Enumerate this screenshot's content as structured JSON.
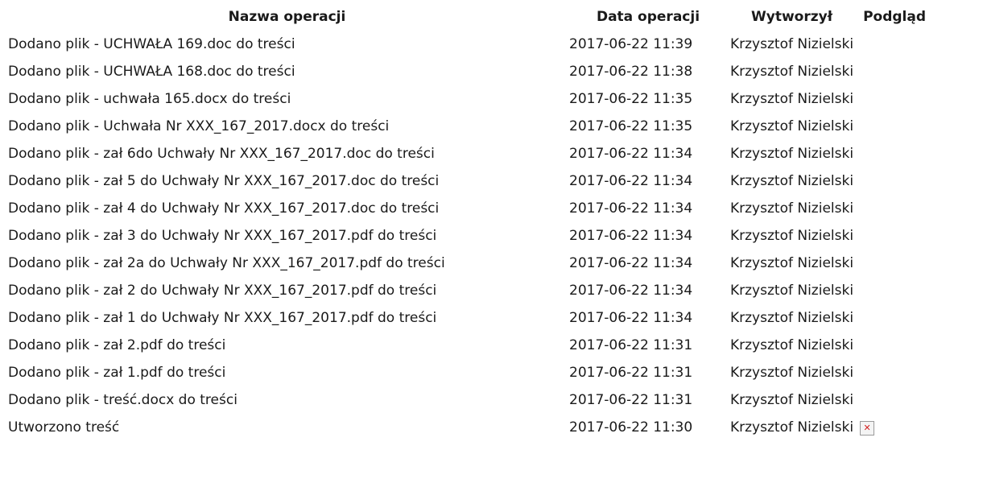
{
  "table": {
    "headers": {
      "name": "Nazwa operacji",
      "date": "Data operacji",
      "user": "Wytworzył",
      "preview": "Podgląd"
    },
    "rows": [
      {
        "name": "Dodano plik - UCHWAŁA 169.doc do treści",
        "date": "2017-06-22 11:39",
        "user": "Krzysztof Nizielski"
      },
      {
        "name": "Dodano plik - UCHWAŁA 168.doc do treści",
        "date": "2017-06-22 11:38",
        "user": "Krzysztof Nizielski"
      },
      {
        "name": "Dodano plik - uchwała 165.docx do treści",
        "date": "2017-06-22 11:35",
        "user": "Krzysztof Nizielski"
      },
      {
        "name": "Dodano plik - Uchwała Nr XXX_167_2017.docx do treści",
        "date": "2017-06-22 11:35",
        "user": "Krzysztof Nizielski"
      },
      {
        "name": "Dodano plik - zał 6do Uchwały Nr XXX_167_2017.doc do treści",
        "date": "2017-06-22 11:34",
        "user": "Krzysztof Nizielski"
      },
      {
        "name": "Dodano plik - zał 5 do Uchwały Nr XXX_167_2017.doc do treści",
        "date": "2017-06-22 11:34",
        "user": "Krzysztof Nizielski"
      },
      {
        "name": "Dodano plik - zał 4 do Uchwały Nr XXX_167_2017.doc do treści",
        "date": "2017-06-22 11:34",
        "user": "Krzysztof Nizielski"
      },
      {
        "name": "Dodano plik - zał 3 do Uchwały Nr XXX_167_2017.pdf do treści",
        "date": "2017-06-22 11:34",
        "user": "Krzysztof Nizielski"
      },
      {
        "name": "Dodano plik - zał 2a do Uchwały Nr XXX_167_2017.pdf do treści",
        "date": "2017-06-22 11:34",
        "user": "Krzysztof Nizielski"
      },
      {
        "name": "Dodano plik - zał 2 do Uchwały Nr XXX_167_2017.pdf do treści",
        "date": "2017-06-22 11:34",
        "user": "Krzysztof Nizielski"
      },
      {
        "name": "Dodano plik - zał 1 do Uchwały Nr XXX_167_2017.pdf do treści",
        "date": "2017-06-22 11:34",
        "user": "Krzysztof Nizielski"
      },
      {
        "name": "Dodano plik - zał 2.pdf do treści",
        "date": "2017-06-22 11:31",
        "user": "Krzysztof Nizielski"
      },
      {
        "name": "Dodano plik - zał 1.pdf do treści",
        "date": "2017-06-22 11:31",
        "user": "Krzysztof Nizielski"
      },
      {
        "name": "Dodano plik - treść.docx do treści",
        "date": "2017-06-22 11:31",
        "user": "Krzysztof Nizielski"
      },
      {
        "name": "Utworzono treść",
        "date": "2017-06-22 11:30",
        "user": "Krzysztof Nizielski",
        "preview_icon": "broken-image-icon"
      }
    ]
  }
}
